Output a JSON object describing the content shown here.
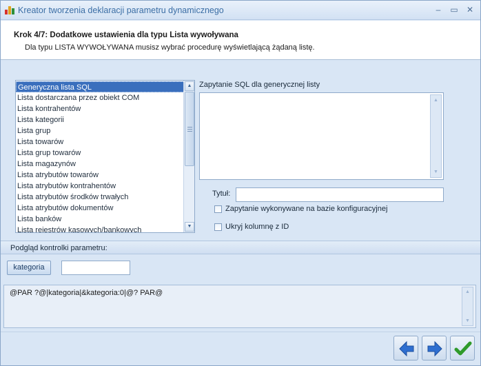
{
  "window": {
    "title": "Kreator tworzenia deklaracji parametru dynamicznego",
    "controls": {
      "minimize": "–",
      "maximize": "▭",
      "close": "✕"
    }
  },
  "header": {
    "step_title": "Krok 4/7: Dodatkowe ustawienia dla typu Lista wywoływana",
    "step_desc": "Dla typu LISTA WYWOŁYWANA musisz wybrać procedurę wyświetlającą żądaną listę."
  },
  "list": {
    "selected_index": 0,
    "items": [
      "Generyczna lista SQL",
      "Lista dostarczana przez obiekt COM",
      "Lista kontrahentów",
      "Lista kategorii",
      "Lista grup",
      "Lista towarów",
      "Lista grup towarów",
      "Lista magazynów",
      "Lista atrybutów towarów",
      "Lista atrybutów kontrahentów",
      "Lista atrybutów środków trwałych",
      "Lista atrybutów dokumentów",
      "Lista banków",
      "Lista rejestrów kasowych/bankowych"
    ]
  },
  "sql": {
    "label": "Zapytanie SQL dla generycznej listy",
    "value": ""
  },
  "title_field": {
    "label": "Tytuł:",
    "value": ""
  },
  "checkboxes": [
    {
      "label": "Zapytanie wykonywane na bazie konfiguracyjnej",
      "checked": false
    },
    {
      "label": "Ukryj kolumnę z ID",
      "checked": false
    }
  ],
  "preview": {
    "label": "Podgląd kontrolki parametru:",
    "button_label": "kategoria",
    "input_value": ""
  },
  "result": {
    "text": "@PAR ?@|kategoria|&kategoria:0|@? PAR@"
  },
  "nav": {
    "back_icon": "arrow-left-icon",
    "next_icon": "arrow-right-icon",
    "finish_icon": "checkmark-icon",
    "colors": {
      "arrow": "#2f6fd0",
      "check": "#2f9a2a"
    }
  },
  "colors": {
    "accent": "#3a6fbd",
    "background": "#d9e6f5",
    "title_text": "#3b6ea5"
  }
}
